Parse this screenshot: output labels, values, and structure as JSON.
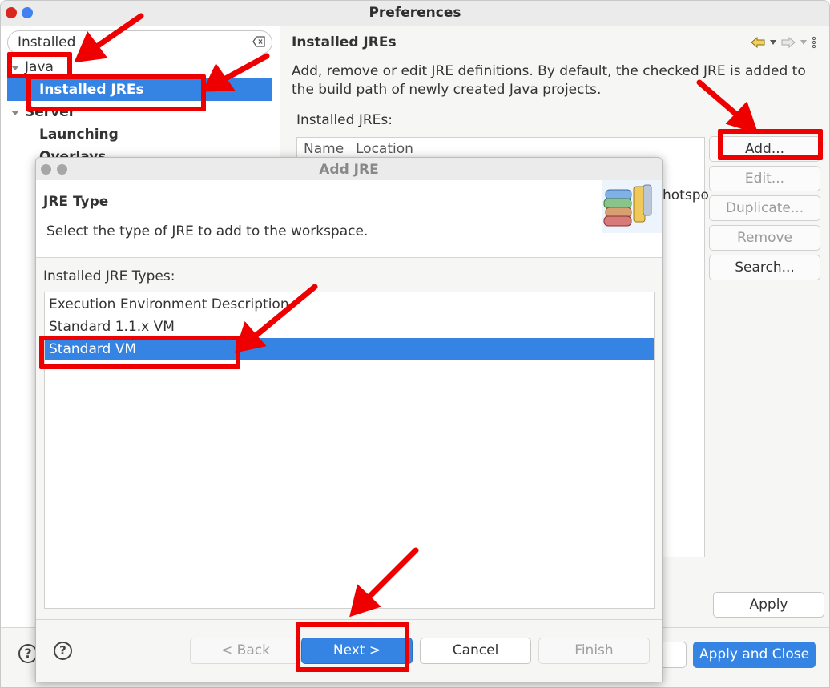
{
  "window": {
    "title": "Preferences"
  },
  "sidebar": {
    "filter_value": "Installed",
    "tree": [
      {
        "label": "Java",
        "level": 0,
        "expanded": true
      },
      {
        "label": "Installed JREs",
        "level": 1,
        "selected": true
      },
      {
        "label": "Server",
        "level": 0,
        "expanded": true
      },
      {
        "label": "Launching",
        "level": 1
      },
      {
        "label": "Overlays",
        "level": 1
      }
    ]
  },
  "main": {
    "title": "Installed JREs",
    "description": "Add, remove or edit JRE definitions. By default, the checked JRE is added to the build path of newly created Java projects.",
    "table_label": "Installed JREs:",
    "columns": [
      "Name",
      "Location"
    ],
    "partial_text": "hotspo",
    "buttons": {
      "add": "Add...",
      "edit": "Edit...",
      "duplicate": "Duplicate...",
      "remove": "Remove",
      "search": "Search..."
    },
    "apply": "Apply"
  },
  "footer": {
    "apply_and_close": "Apply and Close",
    "help": "?"
  },
  "dialog": {
    "title": "Add JRE",
    "banner_title": "JRE Type",
    "banner_desc": "Select the type of JRE to add to the workspace.",
    "list_label": "Installed JRE Types:",
    "types": [
      "Execution Environment Description",
      "Standard 1.1.x VM",
      "Standard VM"
    ],
    "selected_type": "Standard VM",
    "buttons": {
      "back": "< Back",
      "next": "Next >",
      "cancel": "Cancel",
      "finish": "Finish"
    },
    "help": "?"
  },
  "colors": {
    "accent": "#3584e4",
    "annotation": "#ee0000"
  }
}
